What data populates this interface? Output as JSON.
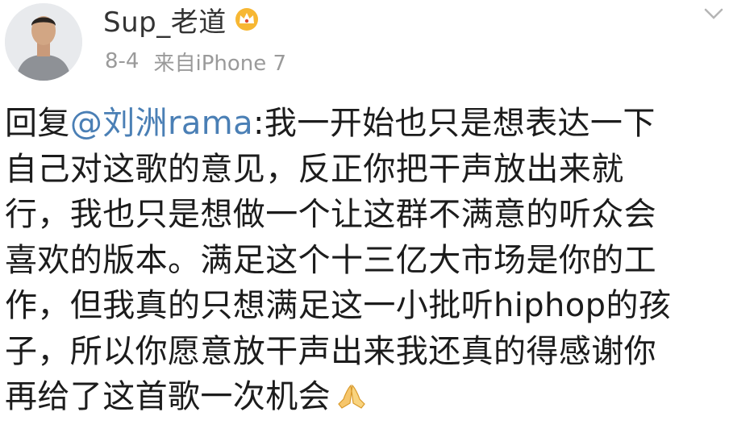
{
  "post": {
    "username": "Sup_老道",
    "badge_icon": "crown-vip-icon",
    "date": "8-4",
    "source": "来自iPhone 7",
    "menu_icon": "chevron-down-icon",
    "reply_prefix": "回复",
    "mention": "@刘洲rama",
    "lines": [
      ":我一开始也只是想表达一下",
      "自己对这歌的意见，反正你把干声放出来就",
      "行，我也只是想做一个让这群不满意的听众会",
      "喜欢的版本。满足这个十三亿大市场是你的工",
      "作，但我真的只想满足这一小批听hiphop的孩",
      "子，所以你愿意放干声出来我还真的得感谢你",
      "再给了这首歌一次机会"
    ],
    "trailing_emoji": "praying-hands-icon",
    "colors": {
      "mention": "#4a7fb5",
      "text": "#1c1c1c",
      "meta": "#9a9a9a",
      "badge": "#f5a623"
    }
  }
}
